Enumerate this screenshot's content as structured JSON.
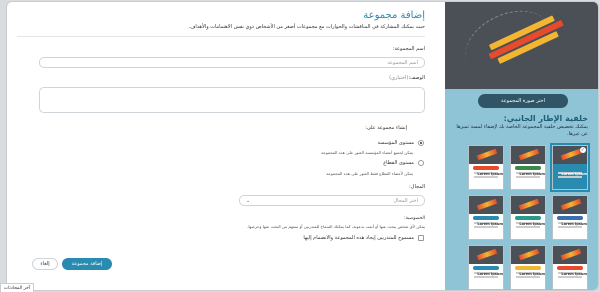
{
  "form": {
    "title": "إضافة مجموعة",
    "subtitle": "حيث يمكنك المشاركة في المناقشات والحوارات مع مجموعات أصغر من الأشخاص ذوي نفس الاهتمامات والأهداف.",
    "name_label": "اسم المجموعة:",
    "name_placeholder": "اسم المجموعة",
    "desc_label": "الوصف:",
    "desc_optional": "(اختياري)",
    "create_on_label": "إنشاء مجموعة على:",
    "option_org": "مستوى المؤسسة",
    "option_org_hint": "يمكن لجميع أعضاء المؤسسة العثور على هذه المجموعة",
    "option_sector": "مستوى القطاع",
    "option_sector_hint": "يمكن لأعضاء القطاع فقط العثور على هذه المجموعة",
    "field_label": "المجال:",
    "field_select": "اختر المجال",
    "privacy_label": "الخصوصية:",
    "privacy_hint": "يمكن لأي شخص يبحث عنها أو أتمت بدعوته، كما يمكنك السماح للمتدربين أو منعهم من البحث عنها وحرصها.",
    "allow_trainees": "مسموح للمتدربين إيجاد هذه المجموعة والانضمام إليها",
    "create_button": "إضافة مجموعة",
    "cancel_button": "إلغاء"
  },
  "side": {
    "upload_button": "اختر صورة المجموعة",
    "title": "خلفية الإطار الجانبي:",
    "desc": "يمكنك تخصيص خلفية المجموعة الخاصة بك لإضفاء لمسة تميزها عن غيرها.",
    "card_label": "Lorem Ipsum",
    "cards": [
      {
        "band": "#2a8bb0",
        "bg": "#2a8bb0",
        "selected": true
      },
      {
        "band": "#3a8a4a",
        "bg": "#ffffff",
        "selected": false
      },
      {
        "band": "#e84a2c",
        "bg": "#ffffff",
        "selected": false
      },
      {
        "band": "#3a6fb0",
        "bg": "#ffffff",
        "selected": false
      },
      {
        "band": "#2a9a8a",
        "bg": "#ffffff",
        "selected": false
      },
      {
        "band": "#2a8bb0",
        "bg": "#ffffff",
        "selected": false
      },
      {
        "band": "#e84a2c",
        "bg": "#ffffff",
        "selected": false
      },
      {
        "band": "#f2b632",
        "bg": "#ffffff",
        "selected": false
      },
      {
        "band": "#2a8bb0",
        "bg": "#ffffff",
        "selected": false
      }
    ]
  },
  "footer": {
    "recent_tab": "آخر المحادثات"
  },
  "colors": {
    "accent": "#2a8bb0",
    "side_bg": "#8fc3d6",
    "hero_bg": "#4a5056"
  }
}
